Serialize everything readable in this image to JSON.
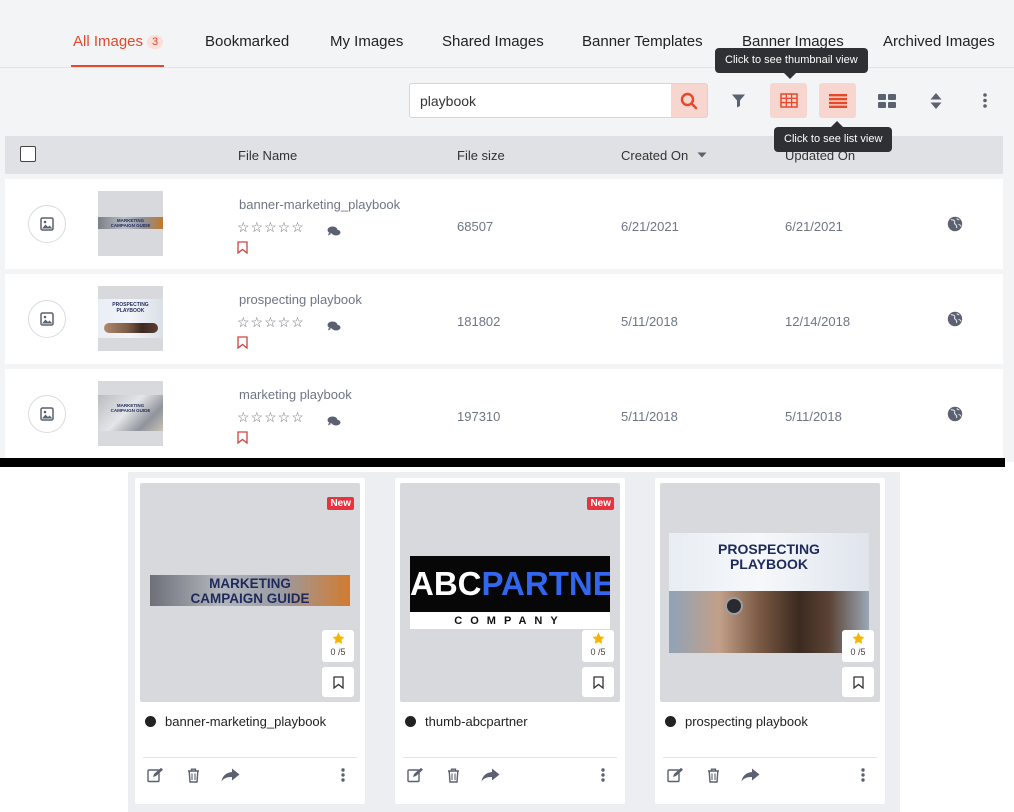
{
  "tabs": [
    {
      "label": "All Images",
      "count": "3"
    },
    {
      "label": "Bookmarked"
    },
    {
      "label": "My Images"
    },
    {
      "label": "Shared Images"
    },
    {
      "label": "Banner Templates"
    },
    {
      "label": "Banner Images"
    },
    {
      "label": "Archived Images"
    }
  ],
  "search": {
    "value": "playbook"
  },
  "tooltips": {
    "thumbnail": "Click to see thumbnail view",
    "list": "Click to see list view"
  },
  "table": {
    "columns": [
      "File Name",
      "File size",
      "Created On",
      "Updated On"
    ],
    "rows": [
      {
        "name": "banner-marketing_playbook",
        "size": "68507",
        "created": "6/21/2021",
        "updated": "6/21/2021",
        "stars": "☆☆☆☆☆"
      },
      {
        "name": "prospecting playbook",
        "size": "181802",
        "created": "5/11/2018",
        "updated": "12/14/2018",
        "stars": "☆☆☆☆☆"
      },
      {
        "name": "marketing playbook",
        "size": "197310",
        "created": "5/11/2018",
        "updated": "5/11/2018",
        "stars": "☆☆☆☆☆"
      }
    ]
  },
  "thumbs": {
    "t1": {
      "line1": "MARKETING",
      "line2": "CAMPAIGN GUIDE"
    },
    "t2": {
      "line1": "PROSPECTING",
      "line2": "PLAYBOOK"
    },
    "t3": {
      "line1": "MARKETING",
      "line2": "CAMPAIGN GUIDE"
    }
  },
  "cards": [
    {
      "title": "banner-marketing_playbook",
      "badge": "New",
      "rating": "0 /5",
      "img_line1": "MARKETING",
      "img_line2": "CAMPAIGN GUIDE"
    },
    {
      "title": "thumb-abcpartner",
      "badge": "New",
      "rating": "0 /5",
      "img_abc": "ABC",
      "img_partner": "PARTNER",
      "img_company": "COMPANY"
    },
    {
      "title": "prospecting playbook",
      "rating": "0 /5",
      "img_line1": "PROSPECTING",
      "img_line2": "PLAYBOOK"
    }
  ],
  "colors": {
    "accent": "#e5492a",
    "accent_bg": "#f7d6cf",
    "new_badge": "#e8323c",
    "header_bg": "#dfe1e5"
  }
}
